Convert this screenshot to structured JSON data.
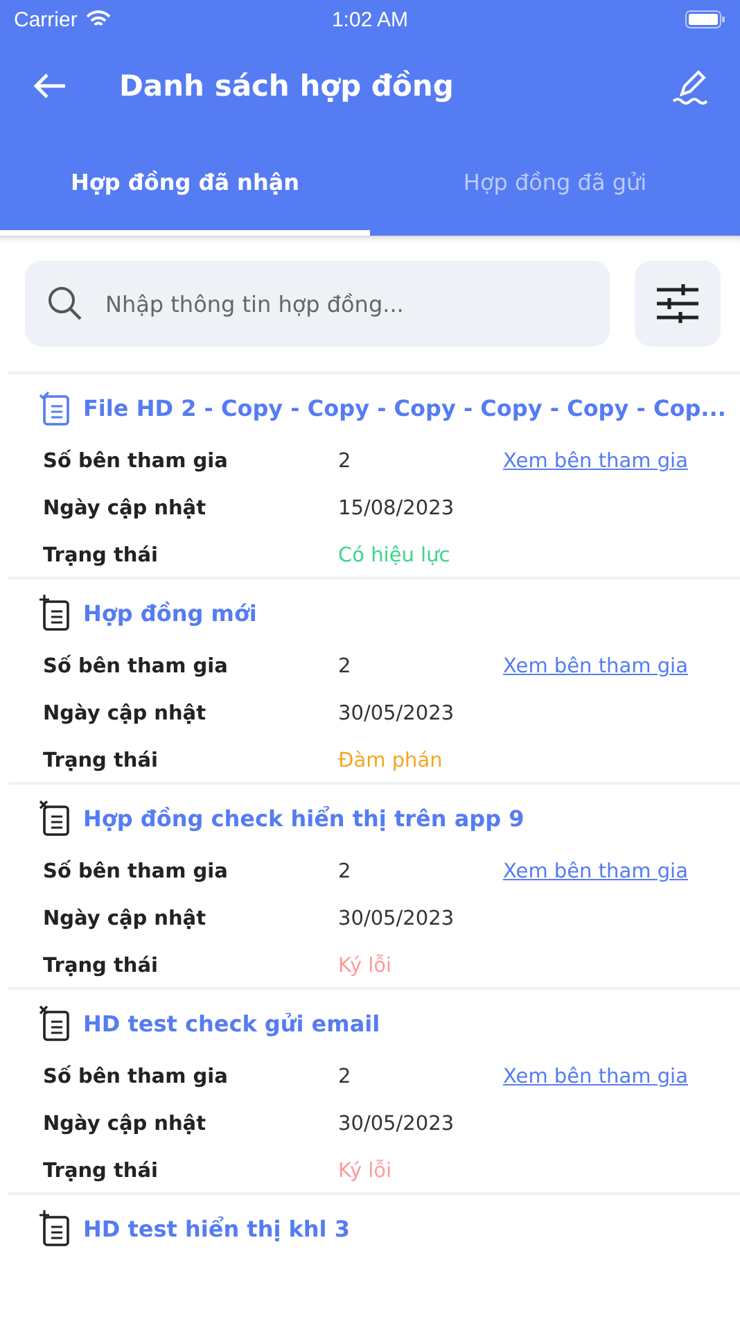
{
  "status_bar": {
    "carrier": "Carrier",
    "time": "1:02 AM"
  },
  "header": {
    "title": "Danh sách hợp đồng"
  },
  "tabs": [
    {
      "label": "Hợp đồng đã nhận",
      "selected": true
    },
    {
      "label": "Hợp đồng đã gửi",
      "selected": false
    }
  ],
  "search": {
    "placeholder": "Nhập thông tin hợp đồng..."
  },
  "contracts": [
    {
      "title": "File HD 2 - Copy - Copy - Copy - Copy - Copy - Cop...",
      "kind": "check",
      "fields": [
        {
          "label": "Số bên tham gia",
          "value": "2",
          "link": "Xem bên tham gia"
        },
        {
          "label": "Ngày cập nhật",
          "value": "15/08/2023"
        },
        {
          "label": "Trạng thái",
          "value": "Có hiệu lực",
          "color": "#3dd68c"
        }
      ]
    },
    {
      "title": "Hợp đồng mới",
      "kind": "plus",
      "fields": [
        {
          "label": "Số bên tham gia",
          "value": "2",
          "link": "Xem bên tham gia"
        },
        {
          "label": "Ngày cập nhật",
          "value": "30/05/2023"
        },
        {
          "label": "Trạng thái",
          "value": "Đàm phán",
          "color": "#f5a623"
        }
      ]
    },
    {
      "title": "Hợp đồng check hiển thị trên app 9",
      "kind": "cross",
      "fields": [
        {
          "label": "Số bên tham gia",
          "value": "2",
          "link": "Xem bên tham gia"
        },
        {
          "label": "Ngày cập nhật",
          "value": "30/05/2023"
        },
        {
          "label": "Trạng thái",
          "value": "Ký lỗi",
          "color": "#ff9a9a"
        }
      ]
    },
    {
      "title": "HD test check gửi email",
      "kind": "cross",
      "fields": [
        {
          "label": "Số bên tham gia",
          "value": "2",
          "link": "Xem bên tham gia"
        },
        {
          "label": "Ngày cập nhật",
          "value": "30/05/2023"
        },
        {
          "label": "Trạng thái",
          "value": "Ký lỗi",
          "color": "#ff9a9a"
        }
      ]
    },
    {
      "title": "HD test hiển thị khl 3",
      "kind": "plus"
    }
  ]
}
